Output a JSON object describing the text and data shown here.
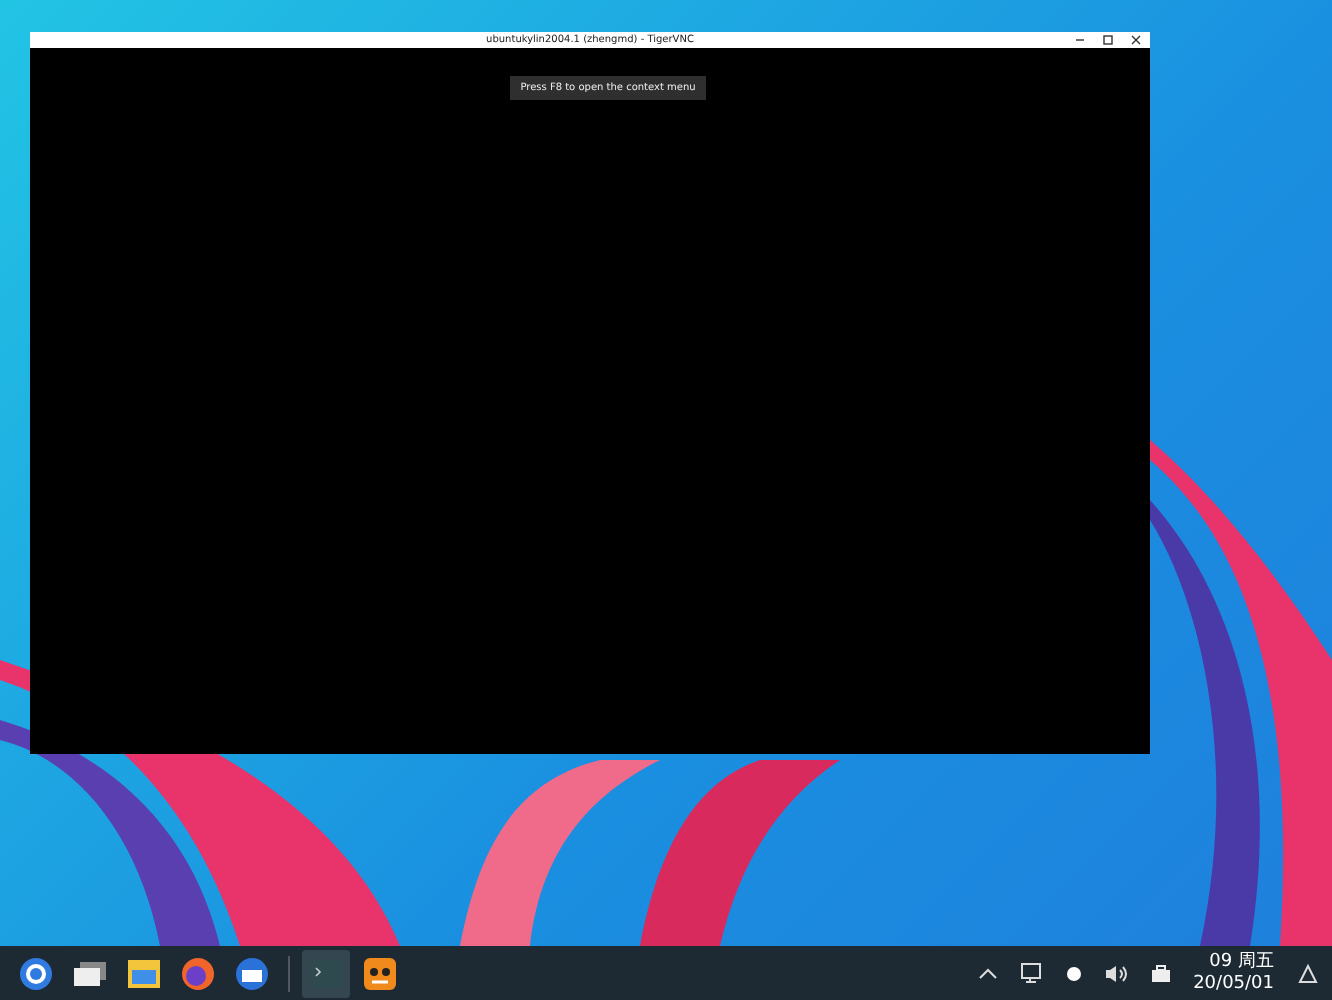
{
  "window": {
    "title": "ubuntukylin2004.1 (zhengmd) - TigerVNC",
    "tooltip": "Press F8 to open the context menu"
  },
  "taskbar": {
    "apps": [
      {
        "kind": "launcher",
        "selected": false
      },
      {
        "kind": "multitask",
        "selected": false
      },
      {
        "kind": "files",
        "selected": false
      },
      {
        "kind": "browser",
        "selected": false
      },
      {
        "kind": "mail",
        "selected": false
      },
      {
        "kind": "terminal",
        "selected": true
      },
      {
        "kind": "vnc",
        "selected": false
      }
    ],
    "clock": {
      "time": "09 周五",
      "date": "20/05/01"
    }
  }
}
